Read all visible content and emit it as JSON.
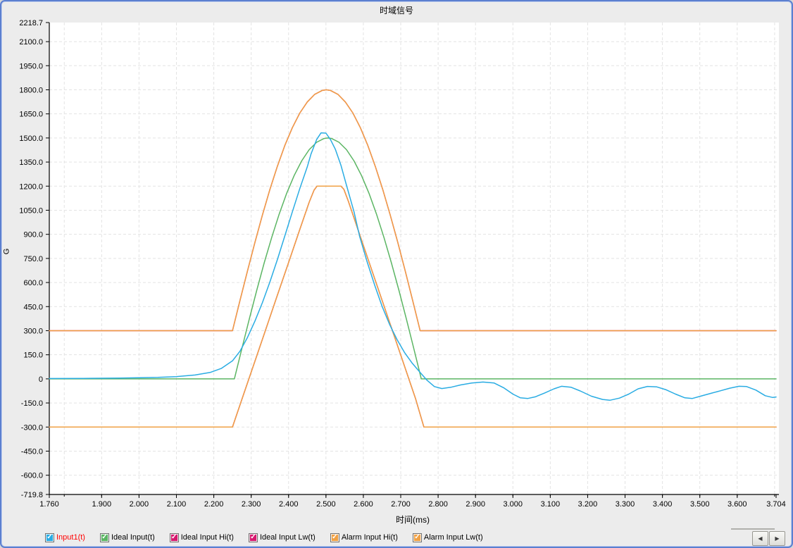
{
  "chart_data": {
    "type": "line",
    "title": "时域信号",
    "xlabel": "时间(ms)",
    "ylabel": "G",
    "xlim": [
      1.76,
      3.704
    ],
    "ylim": [
      -719.8,
      2218.7
    ],
    "grid": "dashed",
    "legend_position": "bottom",
    "x_tick_values": [
      1.76,
      1.9,
      2.0,
      2.1,
      2.2,
      2.3,
      2.4,
      2.5,
      2.6,
      2.7,
      2.8,
      2.9,
      3.0,
      3.1,
      3.2,
      3.3,
      3.4,
      3.5,
      3.6,
      3.704
    ],
    "x_tick_labels": [
      "1.760",
      "1.900",
      "2.000",
      "2.100",
      "2.200",
      "2.300",
      "2.400",
      "2.500",
      "2.600",
      "2.700",
      "2.800",
      "2.900",
      "3.000",
      "3.100",
      "3.200",
      "3.300",
      "3.400",
      "3.500",
      "3.600",
      "3.704"
    ],
    "x_grid_values": [
      1.8,
      1.9,
      2.0,
      2.1,
      2.2,
      2.3,
      2.4,
      2.5,
      2.6,
      2.7,
      2.8,
      2.9,
      3.0,
      3.1,
      3.2,
      3.3,
      3.4,
      3.5,
      3.6,
      3.7
    ],
    "y_tick_values": [
      2218.7,
      2100,
      1950,
      1800,
      1650,
      1500,
      1350,
      1200,
      1050,
      900,
      750,
      600,
      450,
      300,
      150,
      0,
      -150,
      -300,
      -450,
      -600,
      -719.8
    ],
    "y_tick_labels": [
      "2218.7",
      "2100.0",
      "1950.0",
      "1800.0",
      "1650.0",
      "1500.0",
      "1350.0",
      "1200.0",
      "1050.0",
      "900.0",
      "750.0",
      "600.0",
      "450.0",
      "300.0",
      "150.0",
      "0",
      "-150.0",
      "-300.0",
      "-450.0",
      "-600.0",
      "-719.8"
    ],
    "y_grid_values": [
      2100,
      1950,
      1800,
      1650,
      1500,
      1350,
      1200,
      1050,
      900,
      750,
      600,
      450,
      300,
      150,
      0,
      -150,
      -300,
      -450,
      -600
    ],
    "series": [
      {
        "name": "Ideal Input Hi(t)",
        "color": "#d6196e",
        "points_ref": "Alarm Input Hi(t)"
      },
      {
        "name": "Ideal Input Lw(t)",
        "color": "#d6196e",
        "points_ref": "Alarm Input Lw(t)"
      },
      {
        "name": "Alarm Input Hi(t)",
        "color": "#f0a145",
        "points": [
          [
            1.76,
            300
          ],
          [
            2.25,
            300
          ],
          [
            2.27,
            487
          ],
          [
            2.29,
            672
          ],
          [
            2.31,
            850
          ],
          [
            2.33,
            1020
          ],
          [
            2.35,
            1179
          ],
          [
            2.37,
            1323
          ],
          [
            2.39,
            1453
          ],
          [
            2.41,
            1564
          ],
          [
            2.43,
            1655
          ],
          [
            2.45,
            1724
          ],
          [
            2.47,
            1772
          ],
          [
            2.49,
            1796
          ],
          [
            2.501,
            1800
          ],
          [
            2.512,
            1796
          ],
          [
            2.532,
            1772
          ],
          [
            2.552,
            1724
          ],
          [
            2.572,
            1655
          ],
          [
            2.592,
            1564
          ],
          [
            2.612,
            1453
          ],
          [
            2.632,
            1323
          ],
          [
            2.652,
            1179
          ],
          [
            2.672,
            1020
          ],
          [
            2.692,
            850
          ],
          [
            2.712,
            672
          ],
          [
            2.732,
            487
          ],
          [
            2.752,
            300
          ],
          [
            3.704,
            300
          ]
        ]
      },
      {
        "name": "Alarm Input Lw(t)",
        "color": "#f0a145",
        "points": [
          [
            1.76,
            -300
          ],
          [
            2.25,
            -300
          ],
          [
            2.28,
            -95
          ],
          [
            2.31,
            110
          ],
          [
            2.34,
            315
          ],
          [
            2.37,
            520
          ],
          [
            2.4,
            725
          ],
          [
            2.43,
            930
          ],
          [
            2.455,
            1100
          ],
          [
            2.468,
            1175
          ],
          [
            2.476,
            1200
          ],
          [
            2.54,
            1200
          ],
          [
            2.548,
            1180
          ],
          [
            2.56,
            1105
          ],
          [
            2.59,
            900
          ],
          [
            2.62,
            695
          ],
          [
            2.65,
            490
          ],
          [
            2.68,
            285
          ],
          [
            2.71,
            80
          ],
          [
            2.74,
            -125
          ],
          [
            2.762,
            -300
          ],
          [
            3.704,
            -300
          ]
        ]
      },
      {
        "name": "Ideal Input(t)",
        "color": "#5bb563",
        "points": [
          [
            1.76,
            0
          ],
          [
            2.255,
            0
          ],
          [
            2.275,
            188
          ],
          [
            2.295,
            373
          ],
          [
            2.315,
            552
          ],
          [
            2.335,
            723
          ],
          [
            2.355,
            882
          ],
          [
            2.375,
            1027
          ],
          [
            2.395,
            1156
          ],
          [
            2.415,
            1266
          ],
          [
            2.435,
            1357
          ],
          [
            2.455,
            1427
          ],
          [
            2.475,
            1473
          ],
          [
            2.495,
            1497
          ],
          [
            2.505,
            1500
          ],
          [
            2.515,
            1497
          ],
          [
            2.535,
            1473
          ],
          [
            2.555,
            1427
          ],
          [
            2.575,
            1357
          ],
          [
            2.595,
            1266
          ],
          [
            2.615,
            1156
          ],
          [
            2.635,
            1027
          ],
          [
            2.655,
            882
          ],
          [
            2.675,
            723
          ],
          [
            2.695,
            552
          ],
          [
            2.715,
            373
          ],
          [
            2.735,
            188
          ],
          [
            2.755,
            0
          ],
          [
            3.704,
            0
          ]
        ]
      },
      {
        "name": "Input1(t)",
        "color": "#29ace3",
        "points": [
          [
            1.76,
            2
          ],
          [
            1.85,
            3
          ],
          [
            1.95,
            5
          ],
          [
            2.05,
            9
          ],
          [
            2.1,
            14
          ],
          [
            2.15,
            24
          ],
          [
            2.19,
            40
          ],
          [
            2.22,
            65
          ],
          [
            2.25,
            112
          ],
          [
            2.27,
            172
          ],
          [
            2.29,
            258
          ],
          [
            2.31,
            360
          ],
          [
            2.33,
            475
          ],
          [
            2.35,
            603
          ],
          [
            2.37,
            742
          ],
          [
            2.39,
            890
          ],
          [
            2.41,
            1040
          ],
          [
            2.43,
            1185
          ],
          [
            2.45,
            1320
          ],
          [
            2.46,
            1400
          ],
          [
            2.475,
            1490
          ],
          [
            2.487,
            1532
          ],
          [
            2.5,
            1530
          ],
          [
            2.512,
            1490
          ],
          [
            2.525,
            1430
          ],
          [
            2.54,
            1330
          ],
          [
            2.555,
            1205
          ],
          [
            2.575,
            1040
          ],
          [
            2.59,
            888
          ],
          [
            2.61,
            730
          ],
          [
            2.63,
            585
          ],
          [
            2.65,
            452
          ],
          [
            2.67,
            340
          ],
          [
            2.69,
            245
          ],
          [
            2.71,
            165
          ],
          [
            2.73,
            100
          ],
          [
            2.75,
            45
          ],
          [
            2.77,
            -8
          ],
          [
            2.79,
            -48
          ],
          [
            2.81,
            -60
          ],
          [
            2.835,
            -52
          ],
          [
            2.86,
            -38
          ],
          [
            2.89,
            -26
          ],
          [
            2.92,
            -20
          ],
          [
            2.95,
            -26
          ],
          [
            2.975,
            -55
          ],
          [
            3.0,
            -95
          ],
          [
            3.02,
            -118
          ],
          [
            3.04,
            -122
          ],
          [
            3.06,
            -112
          ],
          [
            3.085,
            -88
          ],
          [
            3.11,
            -62
          ],
          [
            3.13,
            -46
          ],
          [
            3.155,
            -52
          ],
          [
            3.18,
            -75
          ],
          [
            3.21,
            -108
          ],
          [
            3.24,
            -128
          ],
          [
            3.26,
            -133
          ],
          [
            3.285,
            -120
          ],
          [
            3.31,
            -95
          ],
          [
            3.335,
            -62
          ],
          [
            3.36,
            -47
          ],
          [
            3.385,
            -50
          ],
          [
            3.41,
            -68
          ],
          [
            3.435,
            -95
          ],
          [
            3.46,
            -118
          ],
          [
            3.48,
            -122
          ],
          [
            3.505,
            -106
          ],
          [
            3.53,
            -90
          ],
          [
            3.555,
            -74
          ],
          [
            3.58,
            -58
          ],
          [
            3.605,
            -46
          ],
          [
            3.625,
            -48
          ],
          [
            3.65,
            -70
          ],
          [
            3.675,
            -105
          ],
          [
            3.695,
            -116
          ],
          [
            3.704,
            -113
          ]
        ]
      }
    ]
  },
  "legend": {
    "check_glyph": "✓",
    "items": [
      {
        "label": "Input1(t)",
        "swatch_color": "#29ace3",
        "label_color": "#ff0000",
        "checked": true
      },
      {
        "label": "Ideal Input(t)",
        "swatch_color": "#5bb563",
        "label_color": "#000000",
        "checked": true
      },
      {
        "label": "Ideal Input Hi(t)",
        "swatch_color": "#d6196e",
        "label_color": "#000000",
        "checked": true
      },
      {
        "label": "Ideal Input Lw(t)",
        "swatch_color": "#d6196e",
        "label_color": "#000000",
        "checked": true
      },
      {
        "label": "Alarm Input Hi(t)",
        "swatch_color": "#f0a145",
        "label_color": "#000000",
        "checked": true
      },
      {
        "label": "Alarm Input Lw(t)",
        "swatch_color": "#f0a145",
        "label_color": "#000000",
        "checked": true
      }
    ]
  },
  "pager": {
    "left_label": "◀",
    "right_label": "▶"
  },
  "colors": {
    "window_border": "#5b7fd0",
    "background": "#ececec",
    "plot_background": "#ffffff",
    "grid": "#e3e3e3",
    "axis": "#000000"
  }
}
